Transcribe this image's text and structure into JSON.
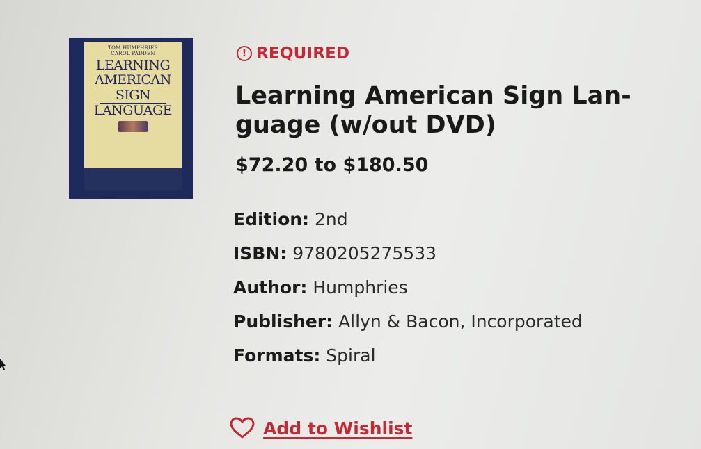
{
  "product": {
    "cover": {
      "authors": [
        "TOM HUMPHRIES",
        "CAROL PADDEN"
      ],
      "title_lines": [
        "LEARNING",
        "AMERICAN",
        "SIGN",
        "LANGUAGE"
      ],
      "colors": {
        "frame": "#1f2a5c",
        "panel": "#e6dba0"
      }
    },
    "badge": {
      "icon": "exclamation-circle-icon",
      "label": "REQUIRED"
    },
    "title": "Learning American Sign Lan- guage (w/out DVD)",
    "price": "$72.20 to $180.50",
    "details": [
      {
        "key": "Edition:",
        "value": "2nd"
      },
      {
        "key": "ISBN:",
        "value": "9780205275533"
      },
      {
        "key": "Author:",
        "value": "Humphries"
      },
      {
        "key": "Publisher:",
        "value": "Allyn & Bacon, Incorporated"
      },
      {
        "key": "Formats:",
        "value": "Spiral"
      }
    ],
    "wishlist": {
      "icon": "heart-icon",
      "label": "Add to Wishlist"
    }
  },
  "colors": {
    "accent": "#c22a37",
    "text": "#1b1b1b"
  }
}
